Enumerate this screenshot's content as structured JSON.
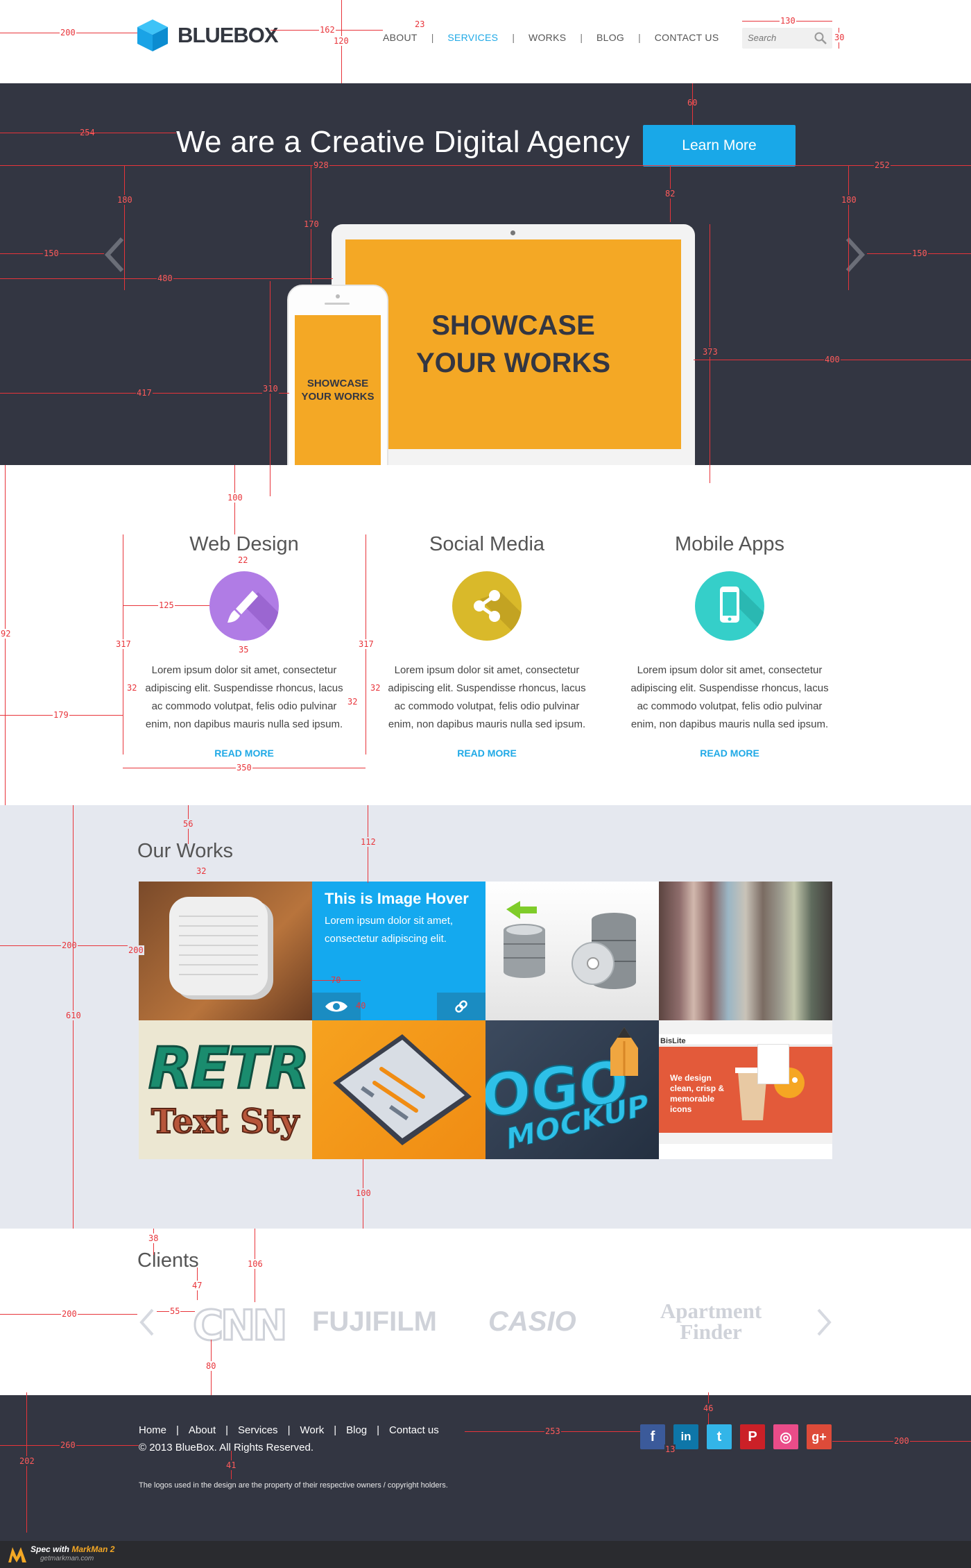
{
  "header": {
    "logo_text": "BLUEBOX",
    "nav": [
      {
        "label": "ABOUT",
        "active": false
      },
      {
        "label": "SERVICES",
        "active": true
      },
      {
        "label": "WORKS",
        "active": false
      },
      {
        "label": "BLOG",
        "active": false
      },
      {
        "label": "CONTACT US",
        "active": false
      }
    ],
    "nav_separator": "|",
    "search_placeholder": "Search"
  },
  "hero": {
    "title": "We are a Creative Digital Agency",
    "cta_label": "Learn More",
    "laptop_text_line1": "SHOWCASE",
    "laptop_text_line2": "YOUR WORKS",
    "phone_text_line1": "SHOWCASE",
    "phone_text_line2": "YOUR WORKS"
  },
  "services": [
    {
      "title": "Web Design",
      "icon": "brush-icon",
      "color": "#b07ce5",
      "text": "Lorem ipsum dolor sit amet, consectetur adipiscing elit. Suspendisse rhoncus, lacus ac commodo volutpat, felis odio pulvinar enim, non dapibus mauris nulla sed ipsum.",
      "more": "READ MORE"
    },
    {
      "title": "Social Media",
      "icon": "share-icon",
      "color": "#d9b92a",
      "text": "Lorem ipsum dolor sit amet, consectetur adipiscing elit. Suspendisse rhoncus, lacus ac commodo volutpat, felis odio pulvinar enim, non dapibus mauris nulla sed ipsum.",
      "more": "READ MORE"
    },
    {
      "title": "Mobile Apps",
      "icon": "mobile-icon",
      "color": "#35cfc9",
      "text": "Lorem ipsum dolor sit amet, consectetur adipiscing elit. Suspendisse rhoncus, lacus ac commodo volutpat, felis odio pulvinar enim, non dapibus mauris nulla sed ipsum.",
      "more": "READ MORE"
    }
  ],
  "works": {
    "title": "Our Works",
    "hover_title": "This is Image Hover",
    "hover_text": "Lorem ipsum dolor sit amet, consectetur adipiscing elit.",
    "tile_retro_line1": "RETR",
    "tile_retro_line2": "Text Sty",
    "tile_logo_line1": "OGO",
    "tile_logo_line2": "MOCKUP",
    "tile_bis_brand": "BisLite",
    "tile_bis_text": "We design clean, crisp & memorable icons"
  },
  "clients": {
    "title": "Clients",
    "logos": [
      "CNN",
      "FUJIFILM",
      "CASIO",
      "Apartment Finder"
    ]
  },
  "footer": {
    "nav": [
      "Home",
      "About",
      "Services",
      "Work",
      "Blog",
      "Contact us"
    ],
    "nav_separator": "|",
    "copyright": "© 2013 BlueBox.  All Rights Reserved.",
    "disclaimer": "The logos used in the design are the property of their respective owners / copyright holders.",
    "social": [
      {
        "icon": "facebook-icon",
        "glyph": "f",
        "color": "#3b5a9a"
      },
      {
        "icon": "linkedin-icon",
        "glyph": "in",
        "color": "#0e76a8"
      },
      {
        "icon": "twitter-icon",
        "glyph": "t",
        "color": "#33b5e8"
      },
      {
        "icon": "pinterest-icon",
        "glyph": "P",
        "color": "#cb2027"
      },
      {
        "icon": "dribbble-icon",
        "glyph": "◎",
        "color": "#ea4c89"
      },
      {
        "icon": "googleplus-icon",
        "glyph": "g+",
        "color": "#dd4b39"
      }
    ]
  },
  "markman": {
    "line1_a": "Spec with ",
    "line1_b": "MarkMan 2",
    "line2": "getmarkman.com"
  },
  "measurements": [
    "200",
    "162",
    "23",
    "120",
    "130",
    "30",
    "60",
    "254",
    "928",
    "252",
    "180",
    "170",
    "82",
    "180",
    "150",
    "480",
    "150",
    "373",
    "400",
    "417",
    "310",
    "100",
    "22",
    "125",
    "317",
    "317",
    "35",
    "92",
    "32",
    "32",
    "179",
    "32",
    "350",
    "56",
    "112",
    "32",
    "200",
    "200",
    "610",
    "70",
    "40",
    "100",
    "38",
    "106",
    "47",
    "200",
    "55",
    "80",
    "46",
    "253",
    "260",
    "13",
    "200",
    "202",
    "41"
  ]
}
